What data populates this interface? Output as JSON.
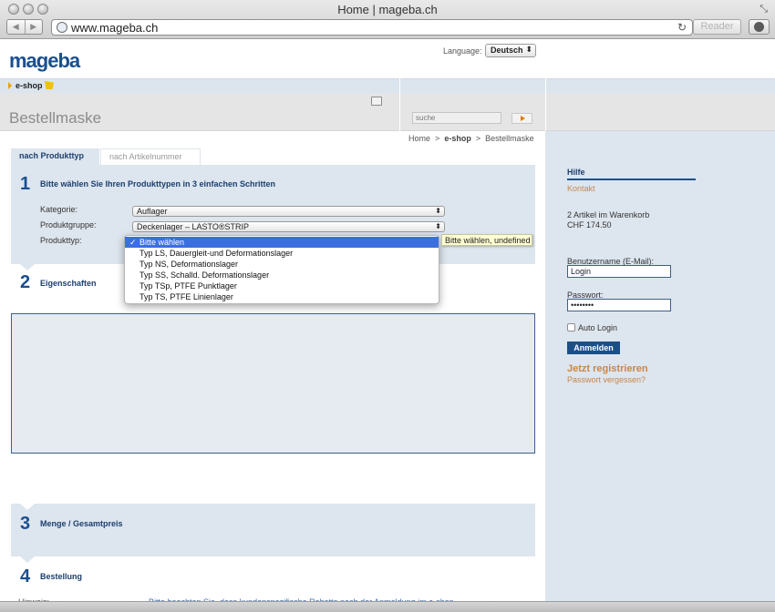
{
  "browser": {
    "window_title": "Home | mageba.ch",
    "url": "www.mageba.ch",
    "reader_label": "Reader",
    "back_icon": "◀",
    "forward_icon": "▶",
    "reload_icon": "↻",
    "resize_icon": "⤡"
  },
  "header": {
    "logo": "mageba",
    "language_label": "Language:",
    "language_value": "Deutsch",
    "eshop_label": "e-shop",
    "page_title": "Bestellmaske",
    "search_placeholder": "suche"
  },
  "breadcrumb": {
    "home": "Home",
    "sep": ">",
    "eshop": "e-shop",
    "current": "Bestellmaske"
  },
  "tabs": [
    {
      "label": "nach Produkttyp",
      "active": true
    },
    {
      "label": "nach Artikelnummer",
      "active": false
    }
  ],
  "step1": {
    "number": "1",
    "title": "Bitte wählen Sie Ihren Produkttypen in 3 einfachen Schritten",
    "kategorie_label": "Kategorie:",
    "kategorie_value": "Auflager",
    "produktgruppe_label": "Produktgruppe:",
    "produktgruppe_value": "Deckenlager – LASTO®STRIP",
    "produkttyp_label": "Produkttyp:"
  },
  "dropdown": {
    "items": [
      "Bitte wählen",
      "Typ LS, Dauergleit-und Deformationslager",
      "Typ NS, Deformationslager",
      "Typ SS, Schalld. Deformationslager",
      "Typ TSp, PTFE Punktlager",
      "Typ TS, PTFE Linienlager"
    ],
    "selected_index": 0,
    "check": "✓",
    "tooltip": "Bitte wählen, undefined"
  },
  "step2": {
    "number": "2",
    "title": "Eigenschaften"
  },
  "step3": {
    "number": "3",
    "title": "Menge / Gesamtpreis"
  },
  "step4": {
    "number": "4",
    "title": "Bestellung",
    "cut_label": "Hinweis:",
    "cut_text": "Bitte beachten Sie, dass kundenspezifische Rabatte nach der Anmeldung im e-shop"
  },
  "sidebar": {
    "hilfe": "Hilfe",
    "kontakt": "Kontakt",
    "cart_line1_count": "2 Artikel im",
    "cart_line1_link": "Warenkorb",
    "cart_total": "CHF 174.50",
    "username_label": "Benutzername (E-Mail):",
    "username_value": "Login",
    "password_label": "Passwort:",
    "password_value": "••••••••",
    "auto_login": "Auto Login",
    "login_button": "Anmelden",
    "register": "Jetzt registrieren",
    "forgot": "Passwort vergessen?"
  },
  "colors": {
    "brand_blue": "#1a4f8f",
    "panel_bg": "#dde5ee",
    "link_orange": "#c9864a",
    "select_highlight": "#3b6fe0"
  }
}
